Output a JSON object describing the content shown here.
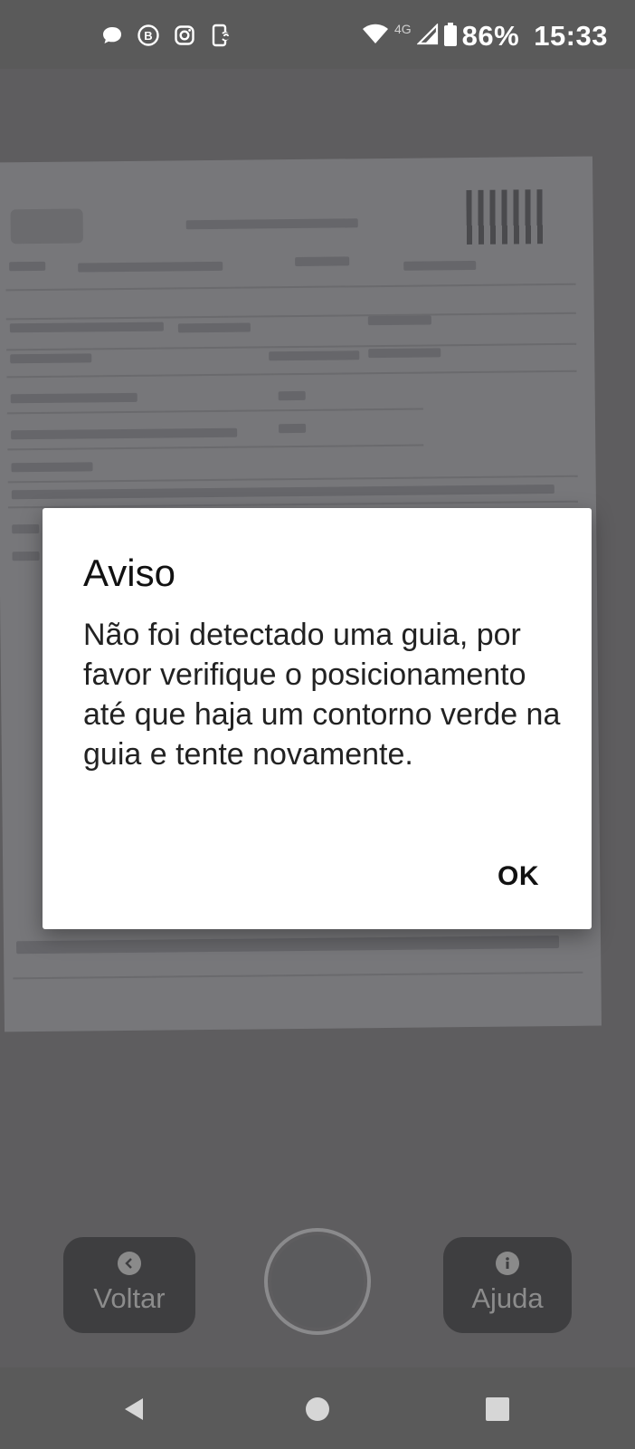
{
  "status_bar": {
    "network_type": "4G",
    "battery": "86%",
    "time": "15:33",
    "notification_icons": [
      "chat-bubble-icon",
      "whatsapp-business-icon",
      "instagram-icon",
      "phone-sync-icon"
    ]
  },
  "dialog": {
    "title": "Aviso",
    "message": "Não foi detectado uma guia, por favor verifique o posicionamento até que haja um contorno verde na guia e tente novamente.",
    "ok_label": "OK"
  },
  "controls": {
    "back_label": "Voltar",
    "help_label": "Ajuda"
  },
  "colors": {
    "dialog_bg": "#ffffff",
    "camera_bg": "#5e5d5f",
    "control_bg": "#3e3e40"
  }
}
